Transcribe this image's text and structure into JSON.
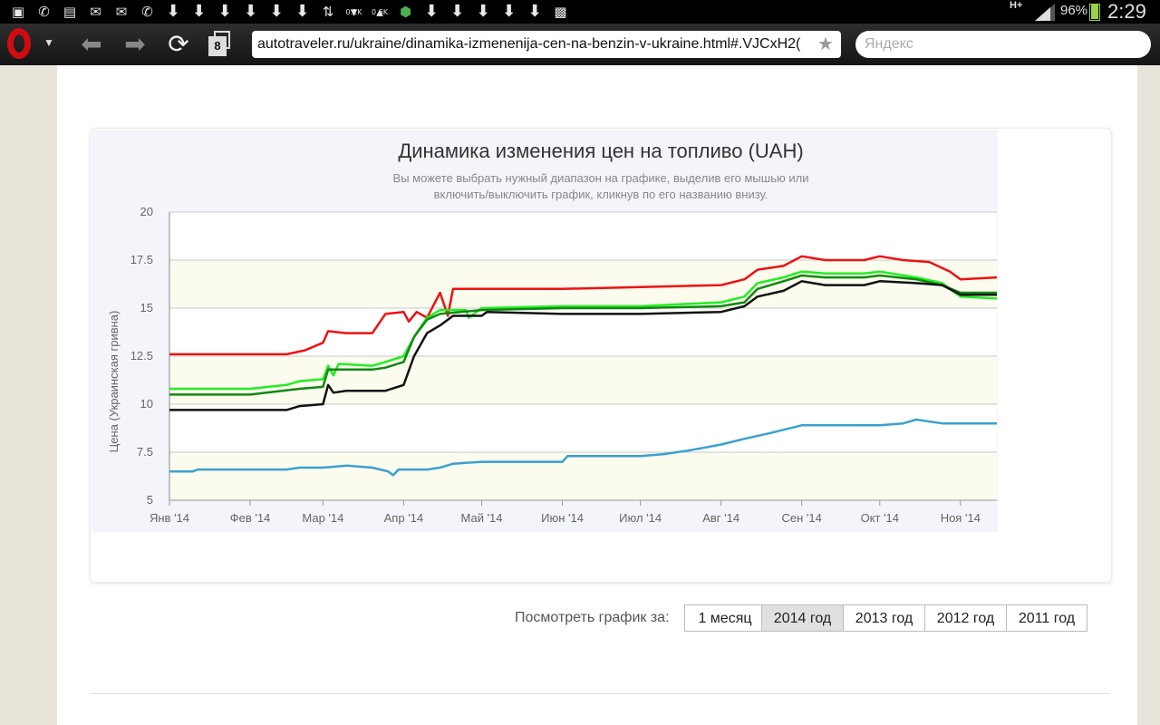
{
  "status_bar": {
    "icons": [
      "image-icon",
      "voicemail-icon",
      "sim-icon",
      "mail-at-icon",
      "mail-at-icon",
      "missed-call-icon",
      "download-icon",
      "download-icon",
      "download-icon",
      "download-icon",
      "download-icon",
      "download-icon",
      "sync-icon",
      "traffic-down-icon",
      "traffic-up-icon",
      "android-icon",
      "download-icon",
      "download-icon",
      "download-icon",
      "download-icon",
      "download-icon",
      "photo-stack-icon"
    ],
    "traffic_down": "0.1K",
    "traffic_up": "0.6K",
    "network": "H+",
    "battery_percent": "96%",
    "battery_level": 0.96,
    "time": "2:29"
  },
  "browser": {
    "tabs_count": "8",
    "url": "autotraveler.ru/ukraine/dinamika-izmenenija-cen-na-benzin-v-ukraine.html#.VJCxH2(",
    "search_placeholder": "Яндекс"
  },
  "chart": {
    "title": "Динамика изменения цен на топливо (UAH)",
    "subtitle_line1": "Вы можете выбрать нужный диапазон на графике, выделив его мышью или",
    "subtitle_line2": "включить/выключить график, кликнув по его названию внизу."
  },
  "chart_data": {
    "type": "line",
    "title": "Динамика изменения цен на топливо (UAH)",
    "subtitle": "Вы можете выбрать нужный диапазон на графике, выделив его мышью или включить/выключить график, кликнув по его названию внизу.",
    "ylabel": "Цена (Украинская гривна)",
    "xlabel": "",
    "x_tick_labels": [
      "Янв '14",
      "Фев '14",
      "Мар '14",
      "Апр '14",
      "Май '14",
      "Июн '14",
      "Июл '14",
      "Авг '14",
      "Сен '14",
      "Окт '14",
      "Ноя '14"
    ],
    "y_ticks": [
      5,
      7.5,
      10,
      12.5,
      15,
      17.5,
      20
    ],
    "y_tick_labels": [
      "5",
      "7.5",
      "10",
      "12.5",
      "15",
      "17.5",
      "20"
    ],
    "ylim": [
      5,
      20
    ],
    "xlim": [
      "2014-01-01",
      "2014-11-15"
    ],
    "grid": true,
    "series": [
      {
        "color": "#ee1111",
        "points": [
          [
            "2014-01-01",
            12.6
          ],
          [
            "2014-02-01",
            12.6
          ],
          [
            "2014-02-15",
            12.6
          ],
          [
            "2014-02-22",
            12.8
          ],
          [
            "2014-03-01",
            13.2
          ],
          [
            "2014-03-03",
            13.8
          ],
          [
            "2014-03-10",
            13.7
          ],
          [
            "2014-03-20",
            13.7
          ],
          [
            "2014-03-25",
            14.7
          ],
          [
            "2014-04-01",
            14.8
          ],
          [
            "2014-04-03",
            14.3
          ],
          [
            "2014-04-06",
            14.8
          ],
          [
            "2014-04-10",
            14.5
          ],
          [
            "2014-04-15",
            15.8
          ],
          [
            "2014-04-18",
            14.6
          ],
          [
            "2014-04-20",
            16.0
          ],
          [
            "2014-05-01",
            16.0
          ],
          [
            "2014-06-01",
            16.0
          ],
          [
            "2014-07-01",
            16.1
          ],
          [
            "2014-08-01",
            16.2
          ],
          [
            "2014-08-10",
            16.5
          ],
          [
            "2014-08-15",
            17.0
          ],
          [
            "2014-08-25",
            17.2
          ],
          [
            "2014-09-01",
            17.7
          ],
          [
            "2014-09-10",
            17.5
          ],
          [
            "2014-09-25",
            17.5
          ],
          [
            "2014-10-01",
            17.7
          ],
          [
            "2014-10-10",
            17.5
          ],
          [
            "2014-10-20",
            17.4
          ],
          [
            "2014-10-28",
            16.9
          ],
          [
            "2014-11-01",
            16.5
          ],
          [
            "2014-11-15",
            16.6
          ]
        ]
      },
      {
        "color": "#22ee22",
        "points": [
          [
            "2014-01-01",
            10.8
          ],
          [
            "2014-02-01",
            10.8
          ],
          [
            "2014-02-15",
            11.0
          ],
          [
            "2014-02-20",
            11.2
          ],
          [
            "2014-03-01",
            11.3
          ],
          [
            "2014-03-03",
            12.0
          ],
          [
            "2014-03-05",
            11.5
          ],
          [
            "2014-03-07",
            12.1
          ],
          [
            "2014-03-20",
            12.0
          ],
          [
            "2014-03-25",
            12.2
          ],
          [
            "2014-04-01",
            12.5
          ],
          [
            "2014-04-05",
            13.5
          ],
          [
            "2014-04-10",
            14.5
          ],
          [
            "2014-04-15",
            14.9
          ],
          [
            "2014-04-25",
            14.9
          ],
          [
            "2014-04-26",
            14.5
          ],
          [
            "2014-05-01",
            15.0
          ],
          [
            "2014-06-01",
            15.1
          ],
          [
            "2014-07-01",
            15.1
          ],
          [
            "2014-08-01",
            15.3
          ],
          [
            "2014-08-10",
            15.6
          ],
          [
            "2014-08-15",
            16.3
          ],
          [
            "2014-08-25",
            16.6
          ],
          [
            "2014-09-01",
            16.9
          ],
          [
            "2014-09-10",
            16.8
          ],
          [
            "2014-09-25",
            16.8
          ],
          [
            "2014-10-01",
            16.9
          ],
          [
            "2014-10-15",
            16.6
          ],
          [
            "2014-10-25",
            16.3
          ],
          [
            "2014-11-01",
            15.6
          ],
          [
            "2014-11-15",
            15.5
          ]
        ]
      },
      {
        "color": "#118811",
        "points": [
          [
            "2014-01-01",
            10.5
          ],
          [
            "2014-02-01",
            10.5
          ],
          [
            "2014-02-20",
            10.8
          ],
          [
            "2014-03-01",
            10.9
          ],
          [
            "2014-03-03",
            11.8
          ],
          [
            "2014-03-20",
            11.8
          ],
          [
            "2014-03-25",
            11.9
          ],
          [
            "2014-04-01",
            12.2
          ],
          [
            "2014-04-05",
            13.5
          ],
          [
            "2014-04-10",
            14.4
          ],
          [
            "2014-04-15",
            14.7
          ],
          [
            "2014-05-01",
            14.9
          ],
          [
            "2014-06-01",
            15.0
          ],
          [
            "2014-07-01",
            15.0
          ],
          [
            "2014-08-01",
            15.1
          ],
          [
            "2014-08-10",
            15.3
          ],
          [
            "2014-08-15",
            16.0
          ],
          [
            "2014-08-25",
            16.4
          ],
          [
            "2014-09-01",
            16.7
          ],
          [
            "2014-09-10",
            16.6
          ],
          [
            "2014-09-25",
            16.6
          ],
          [
            "2014-10-01",
            16.7
          ],
          [
            "2014-10-15",
            16.5
          ],
          [
            "2014-10-25",
            16.2
          ],
          [
            "2014-11-01",
            15.8
          ],
          [
            "2014-11-15",
            15.8
          ]
        ]
      },
      {
        "color": "#111111",
        "points": [
          [
            "2014-01-01",
            9.7
          ],
          [
            "2014-02-01",
            9.7
          ],
          [
            "2014-02-15",
            9.7
          ],
          [
            "2014-02-20",
            9.9
          ],
          [
            "2014-03-01",
            10.0
          ],
          [
            "2014-03-03",
            11.0
          ],
          [
            "2014-03-05",
            10.6
          ],
          [
            "2014-03-10",
            10.7
          ],
          [
            "2014-03-25",
            10.7
          ],
          [
            "2014-04-01",
            11.0
          ],
          [
            "2014-04-05",
            12.5
          ],
          [
            "2014-04-10",
            13.7
          ],
          [
            "2014-04-15",
            14.1
          ],
          [
            "2014-04-20",
            14.6
          ],
          [
            "2014-05-01",
            14.6
          ],
          [
            "2014-05-03",
            14.8
          ],
          [
            "2014-06-01",
            14.7
          ],
          [
            "2014-07-01",
            14.7
          ],
          [
            "2014-08-01",
            14.8
          ],
          [
            "2014-08-10",
            15.1
          ],
          [
            "2014-08-15",
            15.6
          ],
          [
            "2014-08-25",
            15.9
          ],
          [
            "2014-09-01",
            16.4
          ],
          [
            "2014-09-10",
            16.2
          ],
          [
            "2014-09-25",
            16.2
          ],
          [
            "2014-10-01",
            16.4
          ],
          [
            "2014-10-15",
            16.3
          ],
          [
            "2014-10-25",
            16.2
          ],
          [
            "2014-11-01",
            15.7
          ],
          [
            "2014-11-15",
            15.7
          ]
        ]
      },
      {
        "color": "#3ba0d0",
        "points": [
          [
            "2014-01-01",
            6.5
          ],
          [
            "2014-01-10",
            6.5
          ],
          [
            "2014-01-12",
            6.6
          ],
          [
            "2014-02-15",
            6.6
          ],
          [
            "2014-02-20",
            6.7
          ],
          [
            "2014-03-01",
            6.7
          ],
          [
            "2014-03-10",
            6.8
          ],
          [
            "2014-03-20",
            6.7
          ],
          [
            "2014-03-26",
            6.5
          ],
          [
            "2014-03-28",
            6.3
          ],
          [
            "2014-03-30",
            6.6
          ],
          [
            "2014-04-10",
            6.6
          ],
          [
            "2014-04-15",
            6.7
          ],
          [
            "2014-04-20",
            6.9
          ],
          [
            "2014-05-01",
            7.0
          ],
          [
            "2014-06-01",
            7.0
          ],
          [
            "2014-06-03",
            7.3
          ],
          [
            "2014-07-01",
            7.3
          ],
          [
            "2014-07-10",
            7.4
          ],
          [
            "2014-07-20",
            7.6
          ],
          [
            "2014-08-01",
            7.9
          ],
          [
            "2014-08-10",
            8.2
          ],
          [
            "2014-08-20",
            8.5
          ],
          [
            "2014-09-01",
            8.9
          ],
          [
            "2014-09-15",
            8.9
          ],
          [
            "2014-10-01",
            8.9
          ],
          [
            "2014-10-10",
            9.0
          ],
          [
            "2014-10-15",
            9.2
          ],
          [
            "2014-10-20",
            9.1
          ],
          [
            "2014-10-25",
            9.0
          ],
          [
            "2014-11-15",
            9.0
          ]
        ]
      }
    ]
  },
  "period_selector": {
    "label": "Посмотреть график за:",
    "options": [
      "1 месяц",
      "2014 год",
      "2013 год",
      "2012 год",
      "2011 год"
    ],
    "selected": "2014 год"
  }
}
